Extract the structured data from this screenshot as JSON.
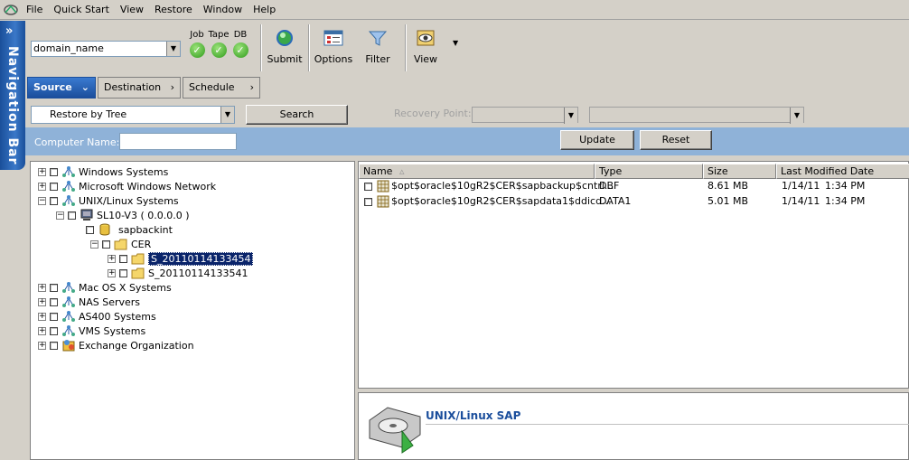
{
  "menu": [
    "File",
    "Quick Start",
    "View",
    "Restore",
    "Window",
    "Help"
  ],
  "nav_bar": {
    "label": "Navigation Bar"
  },
  "toolbar": {
    "domain": "domain_name",
    "status": [
      {
        "label": "Job"
      },
      {
        "label": "Tape"
      },
      {
        "label": "DB"
      }
    ],
    "buttons": {
      "submit": "Submit",
      "options": "Options",
      "filter": "Filter",
      "view": "View"
    }
  },
  "tabs": [
    "Source",
    "Destination",
    "Schedule"
  ],
  "search": {
    "restore_mode": "Restore by Tree",
    "search_button": "Search",
    "recovery_point_label": "Recovery Point:"
  },
  "computer": {
    "label": "Computer Name:",
    "value": "",
    "update_button": "Update",
    "reset_button": "Reset"
  },
  "tree": [
    {
      "label": "Windows Systems",
      "icon": "network-icon"
    },
    {
      "label": "Microsoft Windows Network",
      "icon": "network-icon"
    },
    {
      "label": "UNIX/Linux Systems",
      "icon": "network-icon"
    },
    {
      "label": "SL10-V3 ( 0.0.0.0 )",
      "icon": "computer-icon"
    },
    {
      "label": "sapbackint",
      "icon": "database-icon"
    },
    {
      "label": "CER",
      "icon": "folder-icon"
    },
    {
      "label": "S_20110114133454",
      "icon": "folder-icon",
      "selected": true
    },
    {
      "label": "S_20110114133541",
      "icon": "folder-icon"
    },
    {
      "label": "Mac OS X Systems",
      "icon": "network-icon"
    },
    {
      "label": "NAS Servers",
      "icon": "network-icon"
    },
    {
      "label": "AS400 Systems",
      "icon": "network-icon"
    },
    {
      "label": "VMS Systems",
      "icon": "network-icon"
    },
    {
      "label": "Exchange Organization",
      "icon": "exchange-icon"
    }
  ],
  "file_list": {
    "columns": [
      "Name",
      "Type",
      "Size",
      "Last Modified Date"
    ],
    "rows": [
      {
        "name": "$opt$oracle$10gR2$CER$sapbackup$cntrl...",
        "type": "DBF",
        "size": "8.61 MB",
        "date": "1/14/11",
        "time": "1:34 PM"
      },
      {
        "name": "$opt$oracle$10gR2$CER$sapdata1$ddicd...",
        "type": "DATA1",
        "size": "5.01 MB",
        "date": "1/14/11",
        "time": "1:34 PM"
      }
    ]
  },
  "detail": {
    "title": "UNIX/Linux SAP"
  },
  "colors": {
    "accent": "#1b4e9c",
    "bluebar": "#8fb2d8",
    "selection": "#0a246a"
  }
}
